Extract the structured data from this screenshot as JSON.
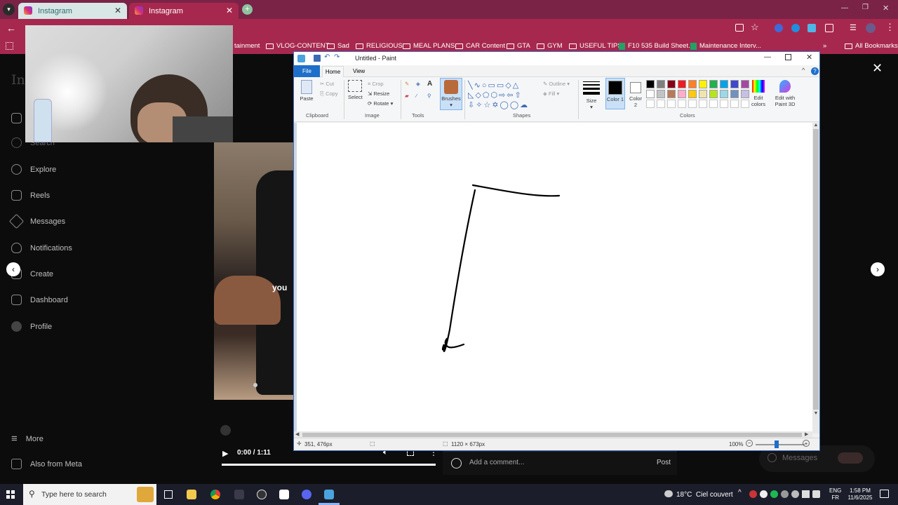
{
  "browser": {
    "tabs": [
      {
        "label": "Instagram",
        "active": false
      },
      {
        "label": "Instagram",
        "active": true
      }
    ],
    "bookmarks": [
      {
        "label": "tainment"
      },
      {
        "label": "VLOG-CONTENT"
      },
      {
        "label": "Sad"
      },
      {
        "label": "RELIGIOUS"
      },
      {
        "label": "MEAL PLANS"
      },
      {
        "label": "CAR Content"
      },
      {
        "label": "GTA"
      },
      {
        "label": "GYM"
      },
      {
        "label": "USEFUL TIPS"
      },
      {
        "label": "F10 535 Build Sheet..."
      },
      {
        "label": "Maintenance Interv..."
      }
    ],
    "all_bookmarks": "All Bookmarks"
  },
  "instagram": {
    "logo": "Ins",
    "nav": [
      {
        "label": "Search",
        "icon": "search-icon"
      },
      {
        "label": "Explore",
        "icon": "compass-icon"
      },
      {
        "label": "Reels",
        "icon": "reels-icon"
      },
      {
        "label": "Messages",
        "icon": "messenger-icon"
      },
      {
        "label": "Notifications",
        "icon": "heart-icon"
      },
      {
        "label": "Create",
        "icon": "plus-icon"
      },
      {
        "label": "Dashboard",
        "icon": "chart-icon"
      },
      {
        "label": "Profile",
        "icon": "avatar-icon"
      },
      {
        "label": "More",
        "icon": "menu-icon"
      },
      {
        "label": "Also from Meta",
        "icon": "meta-icon"
      }
    ],
    "caption": "you",
    "video_time": "0:00 / 1:11",
    "video_progress": 0.0,
    "comment_placeholder": "Add a comment...",
    "post_label": "Post",
    "messages_label": "Messages"
  },
  "paint": {
    "title": "Untitled - Paint",
    "menu": {
      "file": "File",
      "home": "Home",
      "view": "View"
    },
    "clipboard": {
      "paste": "Paste",
      "cut": "Cut",
      "copy": "Copy",
      "group": "Clipboard"
    },
    "image": {
      "select": "Select",
      "crop": "Crop",
      "resize": "Resize",
      "rotate": "Rotate",
      "group": "Image"
    },
    "tools_group": "Tools",
    "brushes": "Brushes",
    "shapes": {
      "outline": "Outline",
      "fill": "Fill",
      "group": "Shapes"
    },
    "size": "Size",
    "color1": "Color 1",
    "color2": "Color 2",
    "colors_group": "Colors",
    "edit_colors": "Edit colors",
    "edit_3d": "Edit with Paint 3D",
    "palette": [
      "#000000",
      "#7f7f7f",
      "#880015",
      "#ed1c24",
      "#ff7f27",
      "#fff200",
      "#22b14c",
      "#00a2e8",
      "#3f48cc",
      "#a349a4",
      "#ffffff",
      "#c3c3c3",
      "#b97a57",
      "#ffaec9",
      "#ffc90e",
      "#efe4b0",
      "#b5e61d",
      "#99d9ea",
      "#7092be",
      "#c8bfe7"
    ],
    "status": {
      "cursor": "351, 476px",
      "canvas_size": "1120 × 673px",
      "zoom": "100%"
    }
  },
  "taskbar": {
    "search_placeholder": "Type here to search",
    "weather": "18°C  Ciel couvert",
    "lang1": "ENG",
    "lang2": "FR",
    "time": "1:58 PM",
    "date": "11/6/2025"
  }
}
